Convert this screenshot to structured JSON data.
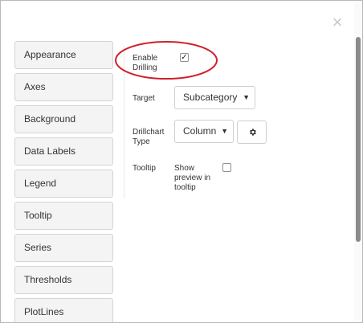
{
  "dialog": {
    "close_symbol": "×"
  },
  "nav": {
    "items": [
      {
        "label": "Appearance"
      },
      {
        "label": "Axes"
      },
      {
        "label": "Background"
      },
      {
        "label": "Data Labels"
      },
      {
        "label": "Legend"
      },
      {
        "label": "Tooltip"
      },
      {
        "label": "Series"
      },
      {
        "label": "Thresholds"
      },
      {
        "label": "PlotLines"
      }
    ]
  },
  "settings": {
    "enable_drilling": {
      "label_line1": "Enable",
      "label_line2": "Drilling",
      "checked": true,
      "check_mark": "✓"
    },
    "target": {
      "label": "Target",
      "value": "Subcategory"
    },
    "drillchart_type": {
      "label_line1": "Drillchart",
      "label_line2": "Type",
      "value": "Column"
    },
    "tooltip": {
      "label": "Tooltip",
      "preview_line1": "Show",
      "preview_line2": "preview in",
      "preview_line3": "tooltip",
      "checked": false
    }
  },
  "icons": {
    "close": "close-icon",
    "gear": "gear-icon",
    "dropdown": "caret-down-icon"
  },
  "colors": {
    "annotation_ellipse": "#d0202a",
    "scrollbar_thumb": "#8b8b8b"
  }
}
